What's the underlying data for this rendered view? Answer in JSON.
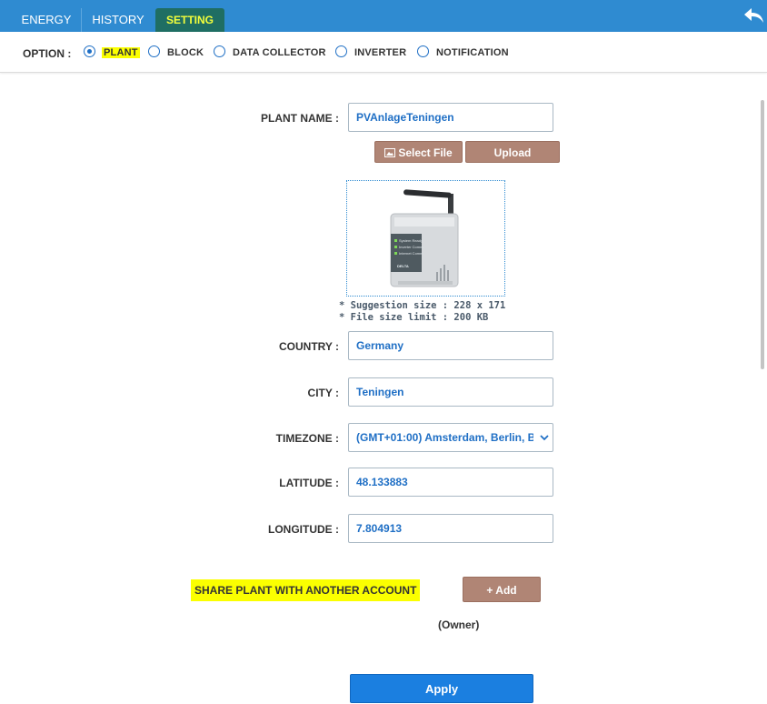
{
  "tabs": [
    {
      "label": "ENERGY"
    },
    {
      "label": "HISTORY"
    },
    {
      "label": "SETTING",
      "active": true
    }
  ],
  "options": {
    "label": "OPTION :",
    "items": [
      {
        "label": "PLANT",
        "selected": true
      },
      {
        "label": "BLOCK"
      },
      {
        "label": "DATA COLLECTOR"
      },
      {
        "label": "INVERTER"
      },
      {
        "label": "NOTIFICATION"
      }
    ]
  },
  "form": {
    "plant_name": {
      "label": "PLANT NAME :",
      "value": "PVAnlageTeningen"
    },
    "select_file": "Select File",
    "upload": "Upload",
    "device_image": {
      "lines": [
        "System Ready",
        "Inverter Comm.",
        "Internet Comm."
      ],
      "brand": "DELTA"
    },
    "hints": [
      "* Suggestion size : 228 x 171",
      "* File size limit : 200 KB"
    ],
    "country": {
      "label": "COUNTRY :",
      "value": "Germany"
    },
    "city": {
      "label": "CITY :",
      "value": "Teningen"
    },
    "timezone": {
      "label": "TIMEZONE :",
      "value": "(GMT+01:00) Amsterdam, Berlin, B"
    },
    "latitude": {
      "label": "LATITUDE :",
      "value": "48.133883"
    },
    "longitude": {
      "label": "LONGITUDE :",
      "value": "7.804913"
    }
  },
  "share": {
    "label": "SHARE PLANT WITH ANOTHER ACCOUNT",
    "add": "+ Add",
    "owner": "(Owner)"
  },
  "apply": "Apply",
  "colors": {
    "topbar": "#2f8bd1",
    "active_tab": "#1f6e63",
    "highlight": "#fbff00",
    "brown_button": "#b08575",
    "apply": "#1b7fe0"
  }
}
